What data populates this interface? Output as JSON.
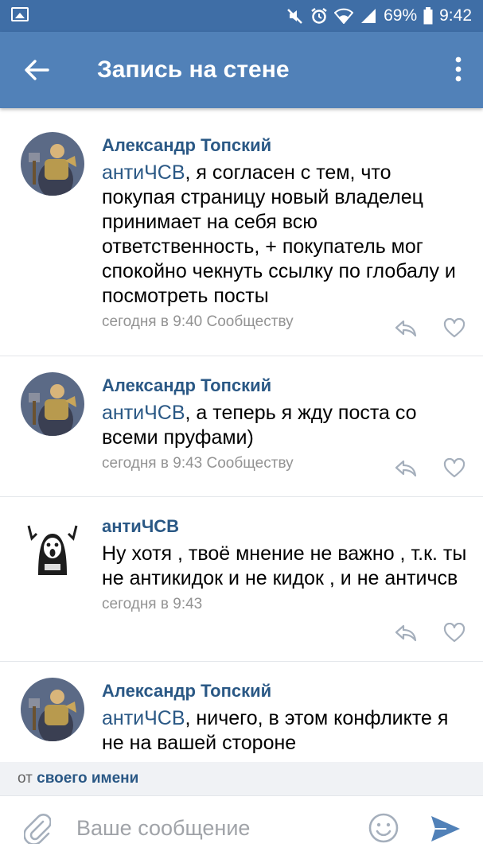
{
  "status_bar": {
    "battery_percent": "69%",
    "time": "9:42"
  },
  "app_bar": {
    "title": "Запись на стене"
  },
  "comments": [
    {
      "author": "Александр Топский",
      "mention": "антиЧСВ",
      "text": ", я согласен с тем, что покупая страницу новый владелец принимает на себя всю ответственность, + покупатель мог спокойно чекнуть ссылку по глобалу и посмотреть посты",
      "time": "сегодня в 9:40",
      "reply_to": "Сообществу",
      "avatar_icon": "warrior-avatar"
    },
    {
      "author": "Александр Топский",
      "mention": "антиЧСВ",
      "text": ", а теперь я жду поста со всеми пруфами)",
      "time": "сегодня в 9:43",
      "reply_to": "Сообществу",
      "avatar_icon": "warrior-avatar"
    },
    {
      "author": "антиЧСВ",
      "mention": "",
      "text": "Ну хотя , твоё мнение не важно , т.к. ты не антикидок и не кидок , и не античсв",
      "time": "сегодня в 9:43",
      "reply_to": "",
      "avatar_icon": "cartoon-avatar"
    },
    {
      "author": "Александр Топский",
      "mention": "антиЧСВ",
      "text": ", ничего, в этом конфликте я не на вашей стороне",
      "time": "",
      "reply_to": "",
      "avatar_icon": "warrior-avatar"
    }
  ],
  "from_bar": {
    "prefix": "от",
    "name": "своего имени"
  },
  "composer": {
    "placeholder": "Ваше сообщение"
  },
  "colors": {
    "status_bar": "#3f6ea6",
    "app_bar": "#5181b8",
    "link": "#2a5885",
    "meta": "#939393",
    "send": "#5181b8"
  }
}
